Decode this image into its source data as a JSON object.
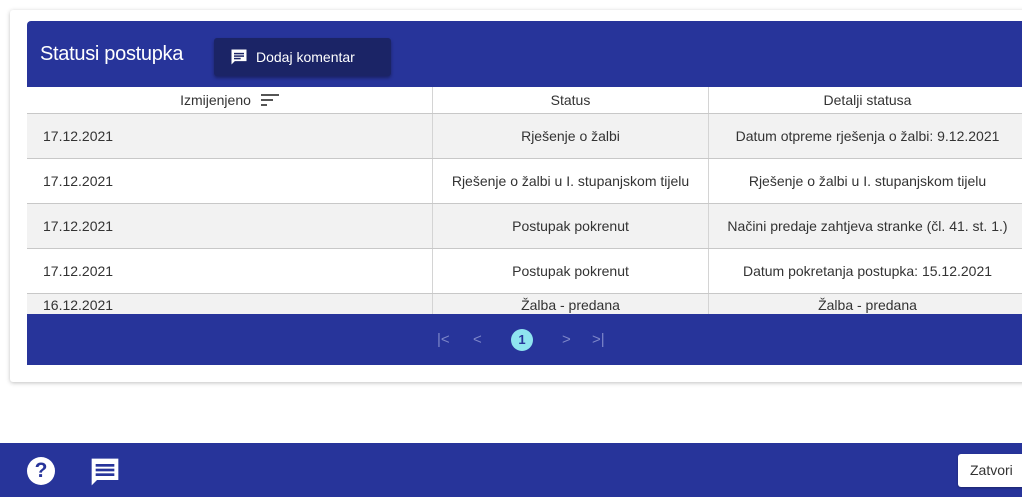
{
  "panel": {
    "title": "Statusi postupka",
    "comment_button_label": "Dodaj komentar"
  },
  "table": {
    "columns": [
      "Izmijenjeno",
      "Status",
      "Detalji statusa"
    ],
    "rows": [
      [
        "17.12.2021",
        "Rješenje o žalbi",
        "Datum otpreme rješenja o žalbi: 9.12.2021"
      ],
      [
        "17.12.2021",
        "Rješenje o žalbi u I. stupanjskom tijelu",
        "Rješenje o žalbi u I. stupanjskom tijelu"
      ],
      [
        "17.12.2021",
        "Postupak pokrenut",
        "Načini predaje zahtjeva stranke (čl. 41. st. 1.)"
      ],
      [
        "17.12.2021",
        "Postupak pokrenut",
        "Datum pokretanja postupka: 15.12.2021"
      ],
      [
        "16.12.2021",
        "Žalba - predana",
        "Žalba - predana"
      ]
    ]
  },
  "pager": {
    "first": "|<",
    "prev": "<",
    "current_page": "1",
    "next": ">",
    "last": ">|"
  },
  "footer": {
    "help_symbol": "?",
    "close_label": "Zatvori"
  },
  "colors": {
    "brand_blue": "#27349a",
    "dark_button": "#1b2466",
    "active_page": "#8fe4f0"
  }
}
